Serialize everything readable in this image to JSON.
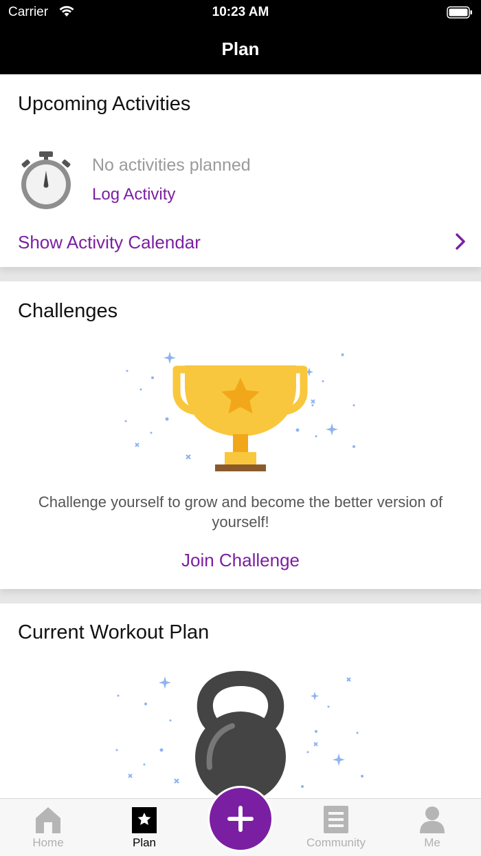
{
  "status_bar": {
    "carrier": "Carrier",
    "time": "10:23 AM"
  },
  "nav": {
    "title": "Plan"
  },
  "upcoming": {
    "title": "Upcoming Activities",
    "empty_text": "No activities planned",
    "log_activity": "Log Activity",
    "show_calendar": "Show Activity Calendar"
  },
  "challenges": {
    "title": "Challenges",
    "description": "Challenge yourself to grow and become the better version of yourself!",
    "join": "Join Challenge"
  },
  "workout": {
    "title": "Current Workout Plan"
  },
  "tab_bar": {
    "home": "Home",
    "plan": "Plan",
    "community": "Community",
    "me": "Me",
    "active_tab": "Plan"
  },
  "colors": {
    "accent": "#7b1fa2",
    "trophy": "#f9c73d",
    "trophy_dark": "#f2a71b",
    "kettlebell": "#444444"
  }
}
